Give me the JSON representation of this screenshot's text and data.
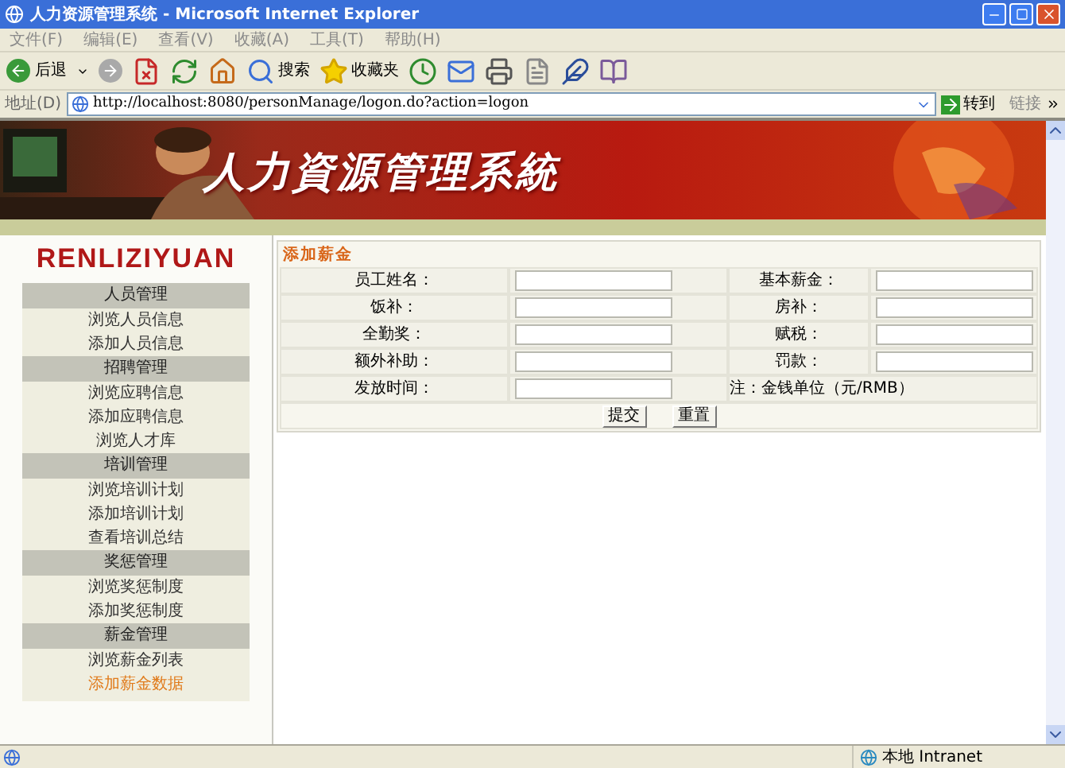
{
  "window": {
    "title": "人力资源管理系统 - Microsoft Internet Explorer"
  },
  "menu": [
    "文件(F)",
    "编辑(E)",
    "查看(V)",
    "收藏(A)",
    "工具(T)",
    "帮助(H)"
  ],
  "toolbar": {
    "back": "后退",
    "search": "搜索",
    "favorites": "收藏夹"
  },
  "address_bar": {
    "label": "地址(D)",
    "url": "http://localhost:8080/personManage/logon.do?action=logon",
    "go": "转到",
    "links": "链接"
  },
  "banner": {
    "title": "人力資源管理系統"
  },
  "sidebar": {
    "logo": "RENLIZIYUAN",
    "groups": [
      {
        "title": "人员管理",
        "items": [
          {
            "label": "浏览人员信息",
            "selected": false
          },
          {
            "label": "添加人员信息",
            "selected": false
          }
        ]
      },
      {
        "title": "招聘管理",
        "items": [
          {
            "label": "浏览应聘信息",
            "selected": false
          },
          {
            "label": "添加应聘信息",
            "selected": false
          },
          {
            "label": "浏览人才库",
            "selected": false
          }
        ]
      },
      {
        "title": "培训管理",
        "items": [
          {
            "label": "浏览培训计划",
            "selected": false
          },
          {
            "label": "添加培训计划",
            "selected": false
          },
          {
            "label": "查看培训总结",
            "selected": false
          }
        ]
      },
      {
        "title": "奖惩管理",
        "items": [
          {
            "label": "浏览奖惩制度",
            "selected": false
          },
          {
            "label": "添加奖惩制度",
            "selected": false
          }
        ]
      },
      {
        "title": "薪金管理",
        "items": [
          {
            "label": "浏览薪金列表",
            "selected": false
          },
          {
            "label": "添加薪金数据",
            "selected": true
          }
        ]
      }
    ]
  },
  "form": {
    "title": "添加薪金",
    "rows": [
      {
        "cells": [
          {
            "kind": "label",
            "text": "员工姓名："
          },
          {
            "kind": "input"
          },
          {
            "kind": "label",
            "text": "基本薪金："
          },
          {
            "kind": "input"
          }
        ]
      },
      {
        "cells": [
          {
            "kind": "label",
            "text": "饭补："
          },
          {
            "kind": "input"
          },
          {
            "kind": "label",
            "text": "房补："
          },
          {
            "kind": "input"
          }
        ]
      },
      {
        "cells": [
          {
            "kind": "label",
            "text": "全勤奖："
          },
          {
            "kind": "input"
          },
          {
            "kind": "label",
            "text": "赋税："
          },
          {
            "kind": "input"
          }
        ]
      },
      {
        "cells": [
          {
            "kind": "label",
            "text": "额外补助："
          },
          {
            "kind": "input"
          },
          {
            "kind": "label",
            "text": "罚款："
          },
          {
            "kind": "input"
          }
        ]
      },
      {
        "cells": [
          {
            "kind": "label",
            "text": "发放时间："
          },
          {
            "kind": "input"
          },
          {
            "kind": "note",
            "text": "注：金钱单位（元/RMB）"
          }
        ]
      }
    ],
    "buttons": [
      "提交",
      "重置"
    ]
  },
  "status_bar": {
    "zone": "本地 Intranet"
  }
}
